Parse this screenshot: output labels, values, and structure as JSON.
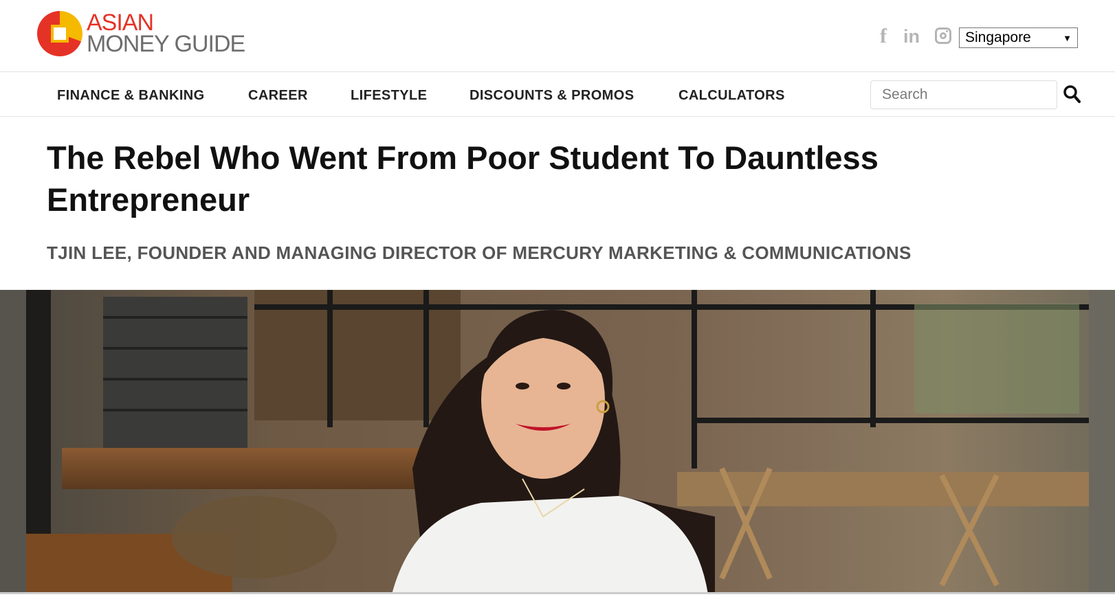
{
  "brand": {
    "line1": "ASIAN",
    "line2": "MONEY GUIDE",
    "colors": {
      "red": "#e53226",
      "yellow": "#f5b900",
      "grey": "#6d6d6d"
    }
  },
  "social": [
    {
      "icon": "facebook-icon"
    },
    {
      "icon": "linkedin-icon"
    },
    {
      "icon": "instagram-icon"
    }
  ],
  "region_select": {
    "value": "Singapore"
  },
  "nav": {
    "items": [
      {
        "label": "FINANCE & BANKING"
      },
      {
        "label": "CAREER"
      },
      {
        "label": "LIFESTYLE"
      },
      {
        "label": "DISCOUNTS & PROMOS"
      },
      {
        "label": "CALCULATORS"
      }
    ],
    "search_placeholder": "Search"
  },
  "article": {
    "title": "The Rebel Who Went From Poor Student To Dauntless Entrepreneur",
    "subtitle": "TJIN LEE, FOUNDER AND MANAGING DIRECTOR OF MERCURY MARKETING & COMMUNICATIONS"
  }
}
